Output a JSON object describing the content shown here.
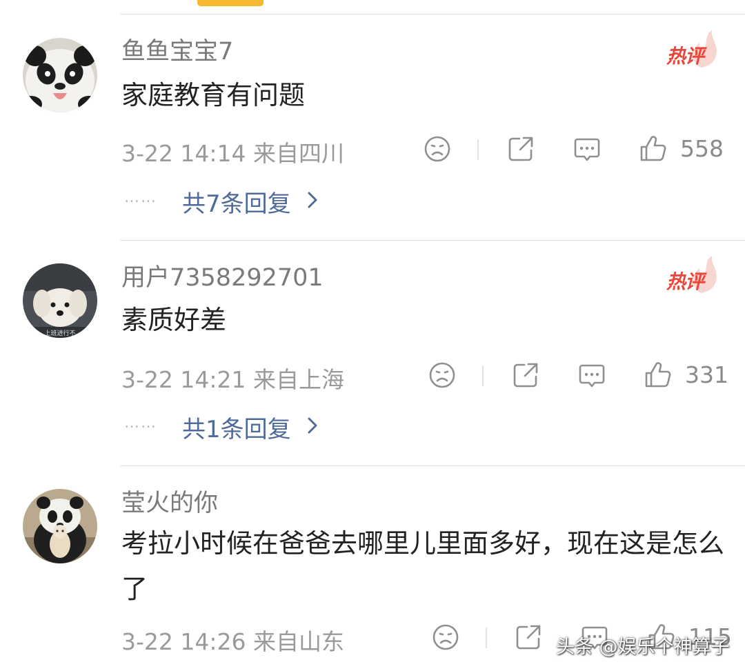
{
  "comments": [
    {
      "username": "鱼鱼宝宝7",
      "hot_badge": "热评",
      "content": "家庭教育有问题",
      "meta": "3-22 14:14 来自四川",
      "likes": "558",
      "replies": "共7条回复",
      "avatar": "panda-face-avatar"
    },
    {
      "username": "用户7358292701",
      "hot_badge": "热评",
      "content": "素质好差",
      "meta": "3-22 14:21 来自上海",
      "likes": "331",
      "replies": "共1条回复",
      "avatar": "white-puppy-avatar"
    },
    {
      "username": "莹火的你",
      "content": "考拉小时候在爸爸去哪里儿里面多好，现在这是怎么了",
      "meta": "3-22 14:26 来自山东",
      "likes": "115",
      "avatar": "panda-with-plush-avatar"
    }
  ],
  "reply_dots": "……",
  "watermark": "头条 @娱乐个神算子",
  "colors": {
    "accent_indicator": "#f5b82e",
    "hot_badge": "#e8483b",
    "reply_link": "#4e6a99",
    "meta_text": "#9a9a9a"
  },
  "icons": [
    "sad-face-icon",
    "share-icon",
    "comment-icon",
    "thumbs-up-icon",
    "chevron-right-icon",
    "hot-flame-icon"
  ]
}
